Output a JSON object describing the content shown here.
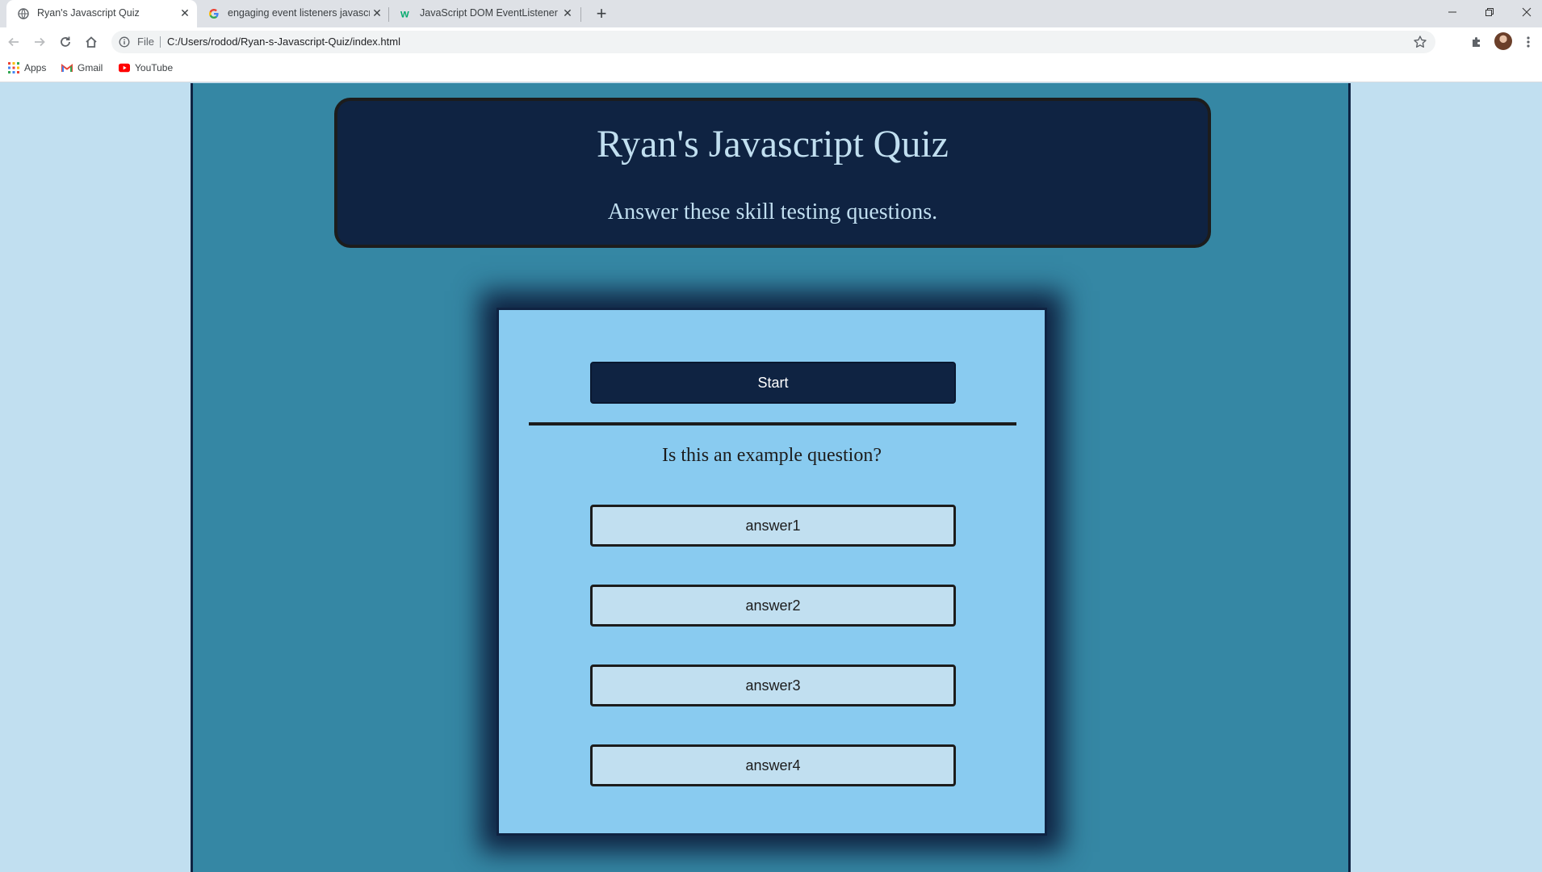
{
  "browser": {
    "tabs": [
      {
        "title": "Ryan's Javascript Quiz",
        "icon": "globe-icon",
        "active": true
      },
      {
        "title": "engaging event listeners javascript",
        "icon": "google-icon",
        "active": false
      },
      {
        "title": "JavaScript DOM EventListener",
        "icon": "w3schools-icon",
        "active": false
      }
    ],
    "address": {
      "scheme": "File",
      "url": "C:/Users/rodod/Ryan-s-Javascript-Quiz/index.html"
    },
    "bookmarks": [
      {
        "label": "Apps",
        "icon": "apps-grid-icon"
      },
      {
        "label": "Gmail",
        "icon": "gmail-icon"
      },
      {
        "label": "YouTube",
        "icon": "youtube-icon"
      }
    ]
  },
  "page": {
    "header": {
      "title": "Ryan's Javascript Quiz",
      "subtitle": "Answer these skill testing questions."
    },
    "quiz": {
      "start_label": "Start",
      "question": "Is this an example question?",
      "answers": [
        "answer1",
        "answer2",
        "answer3",
        "answer4"
      ]
    }
  },
  "colors": {
    "background": "#c1dff0",
    "container": "#3587a4",
    "navy": "#0f2342",
    "card": "#89cbf0",
    "answer_bg": "#c1dff0"
  }
}
